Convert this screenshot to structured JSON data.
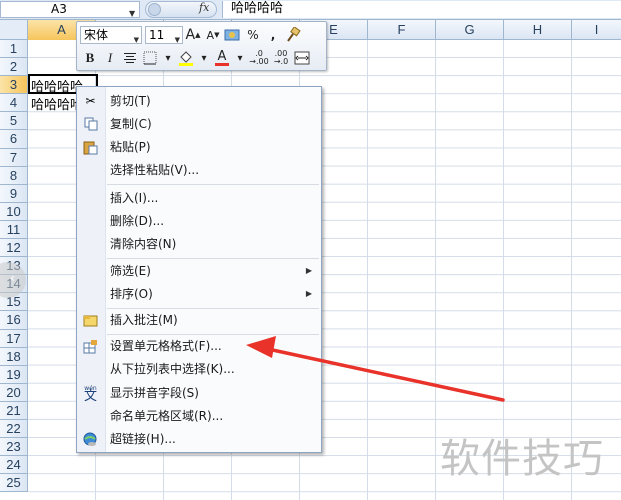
{
  "formula_bar": {
    "name_box": "A3",
    "fx_label": "fx",
    "content": "哈哈哈哈"
  },
  "columns": [
    "A",
    "B",
    "C",
    "D",
    "E",
    "F",
    "G",
    "H",
    "I"
  ],
  "rows": [
    "1",
    "2",
    "3",
    "4",
    "5",
    "6",
    "7",
    "8",
    "9",
    "10",
    "11",
    "12",
    "13",
    "14",
    "15",
    "16",
    "17",
    "18",
    "19",
    "20",
    "21",
    "22",
    "23",
    "24",
    "25"
  ],
  "cells": {
    "A3": "哈哈哈哈",
    "A4": "哈哈哈哈"
  },
  "mini_toolbar": {
    "font_name": "宋体",
    "font_size": "11",
    "grow_font": "A",
    "shrink_font": "A",
    "percent": "%",
    "comma": ",",
    "bold": "B",
    "italic": "I",
    "font_color_letter": "A",
    "inc_decimal": ".0 →.00",
    "dec_decimal": ".00 →.0"
  },
  "context_menu": {
    "items": [
      {
        "label": "剪切(T)",
        "icon": "scissors-icon"
      },
      {
        "label": "复制(C)",
        "icon": "copy-icon"
      },
      {
        "label": "粘贴(P)",
        "icon": "paste-icon"
      },
      {
        "label": "选择性粘贴(V)...",
        "icon": ""
      },
      {
        "label": "插入(I)...",
        "icon": ""
      },
      {
        "label": "删除(D)...",
        "icon": ""
      },
      {
        "label": "清除内容(N)",
        "icon": ""
      },
      {
        "label": "筛选(E)",
        "icon": "",
        "submenu": true
      },
      {
        "label": "排序(O)",
        "icon": "",
        "submenu": true
      },
      {
        "label": "插入批注(M)",
        "icon": "comment-icon"
      },
      {
        "label": "设置单元格格式(F)...",
        "icon": "format-cells-icon"
      },
      {
        "label": "从下拉列表中选择(K)...",
        "icon": ""
      },
      {
        "label": "显示拼音字段(S)",
        "icon": "phonetic-icon"
      },
      {
        "label": "命名单元格区域(R)...",
        "icon": ""
      },
      {
        "label": "超链接(H)...",
        "icon": "hyperlink-icon"
      }
    ]
  },
  "watermark": "软件技巧",
  "colors": {
    "header_bg": "#dbe6f4",
    "selected_header": "#f6c55c",
    "arrow": "#e8322a"
  }
}
